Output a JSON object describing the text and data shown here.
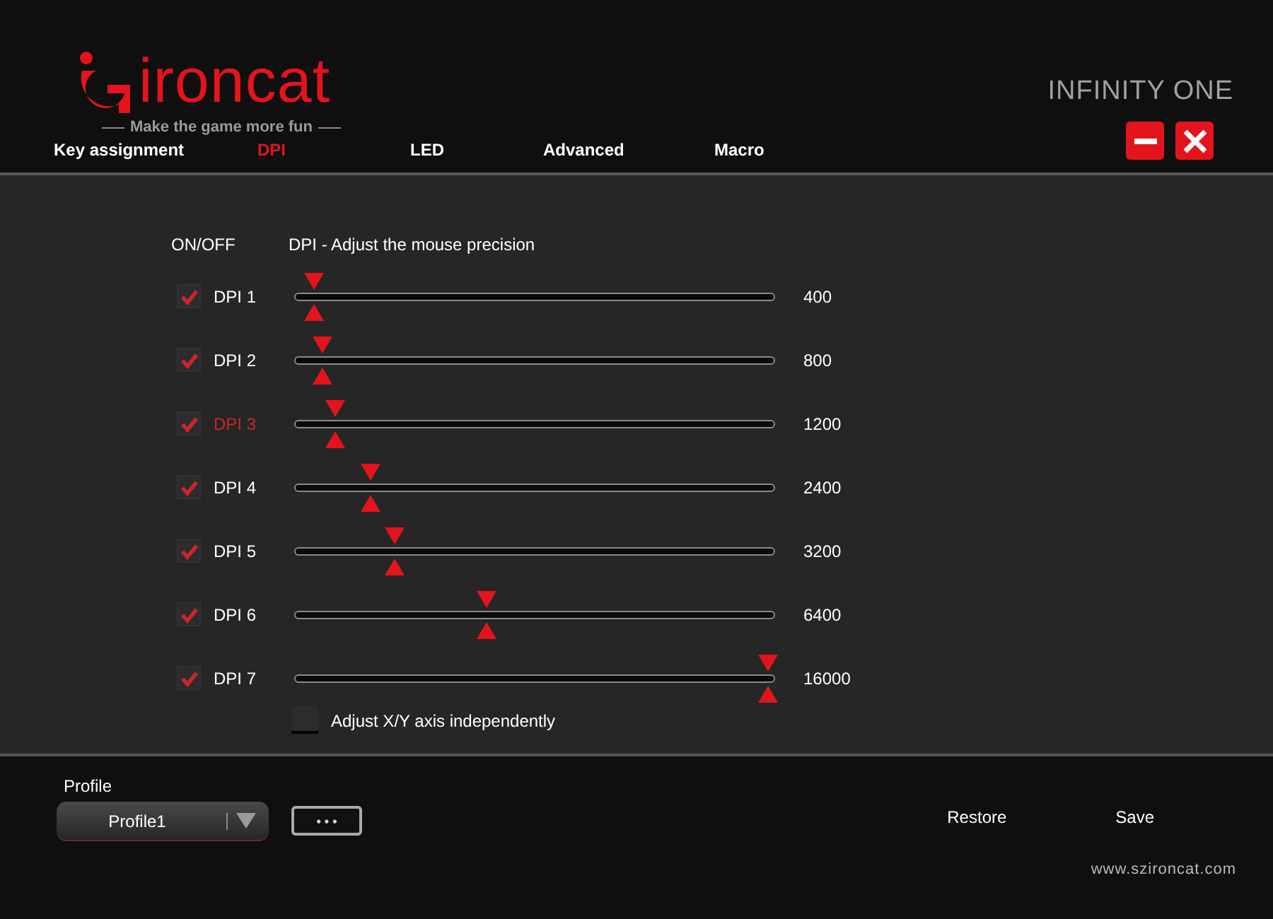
{
  "brand": {
    "name": "ironcat",
    "tagline": "Make the game more fun"
  },
  "product": "INFINITY ONE",
  "tabs": [
    {
      "label": "Key assignment",
      "selected": false
    },
    {
      "label": "DPI",
      "selected": true
    },
    {
      "label": "LED",
      "selected": false
    },
    {
      "label": "Advanced",
      "selected": false
    },
    {
      "label": "Macro",
      "selected": false
    }
  ],
  "headers": {
    "on_off": "ON/OFF",
    "dpi": "DPI  -  Adjust the mouse precision"
  },
  "dpi_levels": [
    {
      "label": "DPI 1",
      "checked": true,
      "selected": false,
      "level": 0.04,
      "reading": "400"
    },
    {
      "label": "DPI 2",
      "checked": true,
      "selected": false,
      "level": 0.06,
      "reading": "800"
    },
    {
      "label": "DPI 3",
      "checked": true,
      "selected": true,
      "level": 0.085,
      "reading": "1200"
    },
    {
      "label": "DPI 4",
      "checked": true,
      "selected": false,
      "level": 0.16,
      "reading": "2400"
    },
    {
      "label": "DPI 5",
      "checked": true,
      "selected": false,
      "level": 0.21,
      "reading": "3200"
    },
    {
      "label": "DPI 6",
      "checked": true,
      "selected": false,
      "level": 0.4,
      "reading": "6400"
    },
    {
      "label": "DPI 7",
      "checked": true,
      "selected": false,
      "level": 0.985,
      "reading": "16000"
    }
  ],
  "xy_independent": {
    "label": "Adjust X/Y axis independently",
    "checked": false
  },
  "profile": {
    "label": "Profile",
    "value": "Profile1",
    "more": "• • •"
  },
  "actions": [
    "Restore",
    "Save"
  ],
  "website": "www.szironcat.com"
}
